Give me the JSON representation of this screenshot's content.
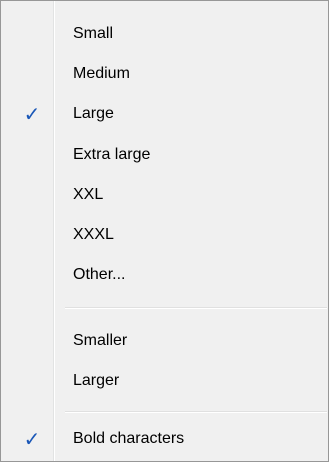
{
  "menu": {
    "items": [
      {
        "label": "Small",
        "checked": false
      },
      {
        "label": "Medium",
        "checked": false
      },
      {
        "label": "Large",
        "checked": true
      },
      {
        "label": "Extra large",
        "checked": false
      },
      {
        "label": "XXL",
        "checked": false
      },
      {
        "label": "XXXL",
        "checked": false
      },
      {
        "label": "Other...",
        "checked": false
      },
      {
        "label": "Smaller",
        "checked": false
      },
      {
        "label": "Larger",
        "checked": false
      },
      {
        "label": "Bold characters",
        "checked": true
      }
    ],
    "check_glyph": "✓",
    "check_color": "#1a57b7"
  }
}
